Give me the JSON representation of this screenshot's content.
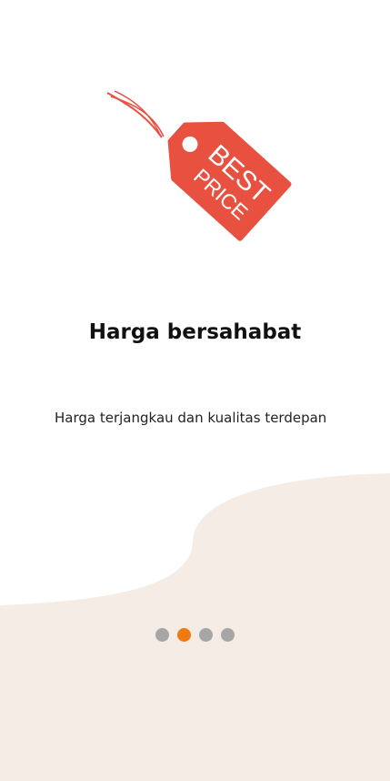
{
  "onboarding": {
    "illustration": {
      "icon": "best-price-tag-icon",
      "tag_text_line1": "BEST",
      "tag_text_line2": "PRICE"
    },
    "title": "Harga bersahabat",
    "subtitle": "Harga terjangkau dan kualitas terdepan",
    "pagination": {
      "total": 4,
      "active_index": 1
    }
  },
  "colors": {
    "tag": "#e8503f",
    "background_wave": "#f6ece6",
    "dot_inactive": "#a6a6a6",
    "dot_active": "#f07a12"
  }
}
